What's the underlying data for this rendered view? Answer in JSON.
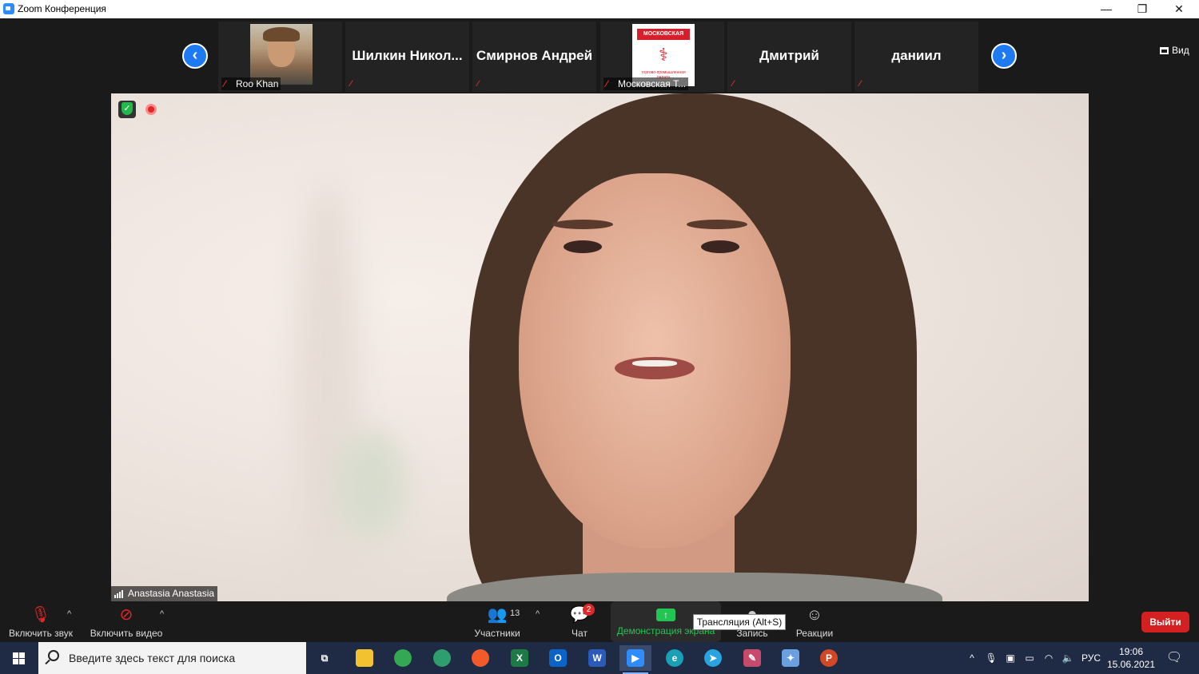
{
  "window": {
    "title": "Zoom Конференция",
    "minimize": "—",
    "restore": "❐",
    "close": "✕"
  },
  "gallery": {
    "prev_arrow": "‹",
    "next_arrow": "›",
    "view_label": "Вид",
    "tiles": [
      {
        "name": "Roo Khan",
        "muted": true
      },
      {
        "name": "Шилкин  Никол...",
        "muted": true
      },
      {
        "name": "Смирнов Андрей",
        "muted": true
      },
      {
        "name": "Московская Т...",
        "muted": true
      },
      {
        "name": "Дмитрий",
        "muted": true
      },
      {
        "name": "даниил",
        "muted": true
      }
    ],
    "logo_title": "МОСКОВСКАЯ",
    "logo_sub": "торгово-промышленная палата"
  },
  "main_video": {
    "speaker_name": "Anastasia Anastasia"
  },
  "toolbar": {
    "audio_label": "Включить звук",
    "video_label": "Включить видео",
    "participants_label": "Участники",
    "participants_count": "13",
    "chat_label": "Чат",
    "chat_badge": "2",
    "share_label": "Демонстрация экрана",
    "record_label": "Запись",
    "reactions_label": "Реакции",
    "tooltip": "Трансляция (Alt+S)",
    "leave_label": "Выйти",
    "caret": "^"
  },
  "taskbar": {
    "search_placeholder": "Введите здесь текст для поиска",
    "apps": [
      {
        "icon": "task-view-icon",
        "glyph": "⧉",
        "color": "#1f2a44"
      },
      {
        "icon": "file-explorer-icon",
        "glyph": "",
        "color": "#f2c230"
      },
      {
        "icon": "chrome-icon",
        "glyph": "",
        "color": "#34a853"
      },
      {
        "icon": "globe-app-icon",
        "glyph": "",
        "color": "#2f9e6e"
      },
      {
        "icon": "yandex-icon",
        "glyph": "",
        "color": "#f25a2a"
      },
      {
        "icon": "excel-icon",
        "glyph": "X",
        "color": "#1d7a45"
      },
      {
        "icon": "outlook-icon",
        "glyph": "O",
        "color": "#0a64c8"
      },
      {
        "icon": "word-icon",
        "glyph": "W",
        "color": "#2b5bb8"
      },
      {
        "icon": "zoom-icon",
        "glyph": "▶",
        "color": "#2d8cff"
      },
      {
        "icon": "edge-icon",
        "glyph": "e",
        "color": "#1a9fb5"
      },
      {
        "icon": "telegram-icon",
        "glyph": "➤",
        "color": "#2aa3e0"
      },
      {
        "icon": "paint-app-icon",
        "glyph": "✎",
        "color": "#c84a6a"
      },
      {
        "icon": "paint-3d-icon",
        "glyph": "✦",
        "color": "#6aa0e0"
      },
      {
        "icon": "powerpoint-icon",
        "glyph": "P",
        "color": "#d24726"
      }
    ],
    "language": "РУС",
    "time": "19:06",
    "date": "15.06.2021"
  }
}
